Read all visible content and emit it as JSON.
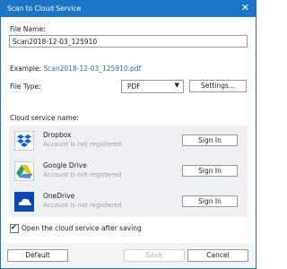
{
  "window": {
    "title": "Scan to Cloud Service",
    "close_glyph": "✕"
  },
  "file_name": {
    "label": "File Name:",
    "value": "Scan2018-12-03_125910"
  },
  "example": {
    "label": "Example:",
    "value": "Scan2018-12-03_125910.pdf"
  },
  "file_type": {
    "label": "File Type:",
    "selected": "PDF",
    "arrow": "▼",
    "settings_label": "Settings..."
  },
  "cloud": {
    "label": "Cloud service name:",
    "services": [
      {
        "name": "Dropbox",
        "status": "Account is not registered",
        "button": "Sign In",
        "icon": "dropbox-icon",
        "color": "#0061fe"
      },
      {
        "name": "Google Drive",
        "status": "Account is not registered",
        "button": "Sign In",
        "icon": "google-drive-icon",
        "color": "#1fa463"
      },
      {
        "name": "OneDrive",
        "status": "Account is not registered",
        "button": "Sign In",
        "icon": "onedrive-icon",
        "color": "#094ab2"
      }
    ]
  },
  "open_after_saving": {
    "label": "Open the cloud service after saving",
    "checked": true,
    "mark": "✔"
  },
  "footer": {
    "default_label": "Default",
    "save_label": "Save",
    "cancel_label": "Cancel"
  },
  "colors": {
    "titlebar": "#1b76c9",
    "link": "#2a6fb5"
  }
}
